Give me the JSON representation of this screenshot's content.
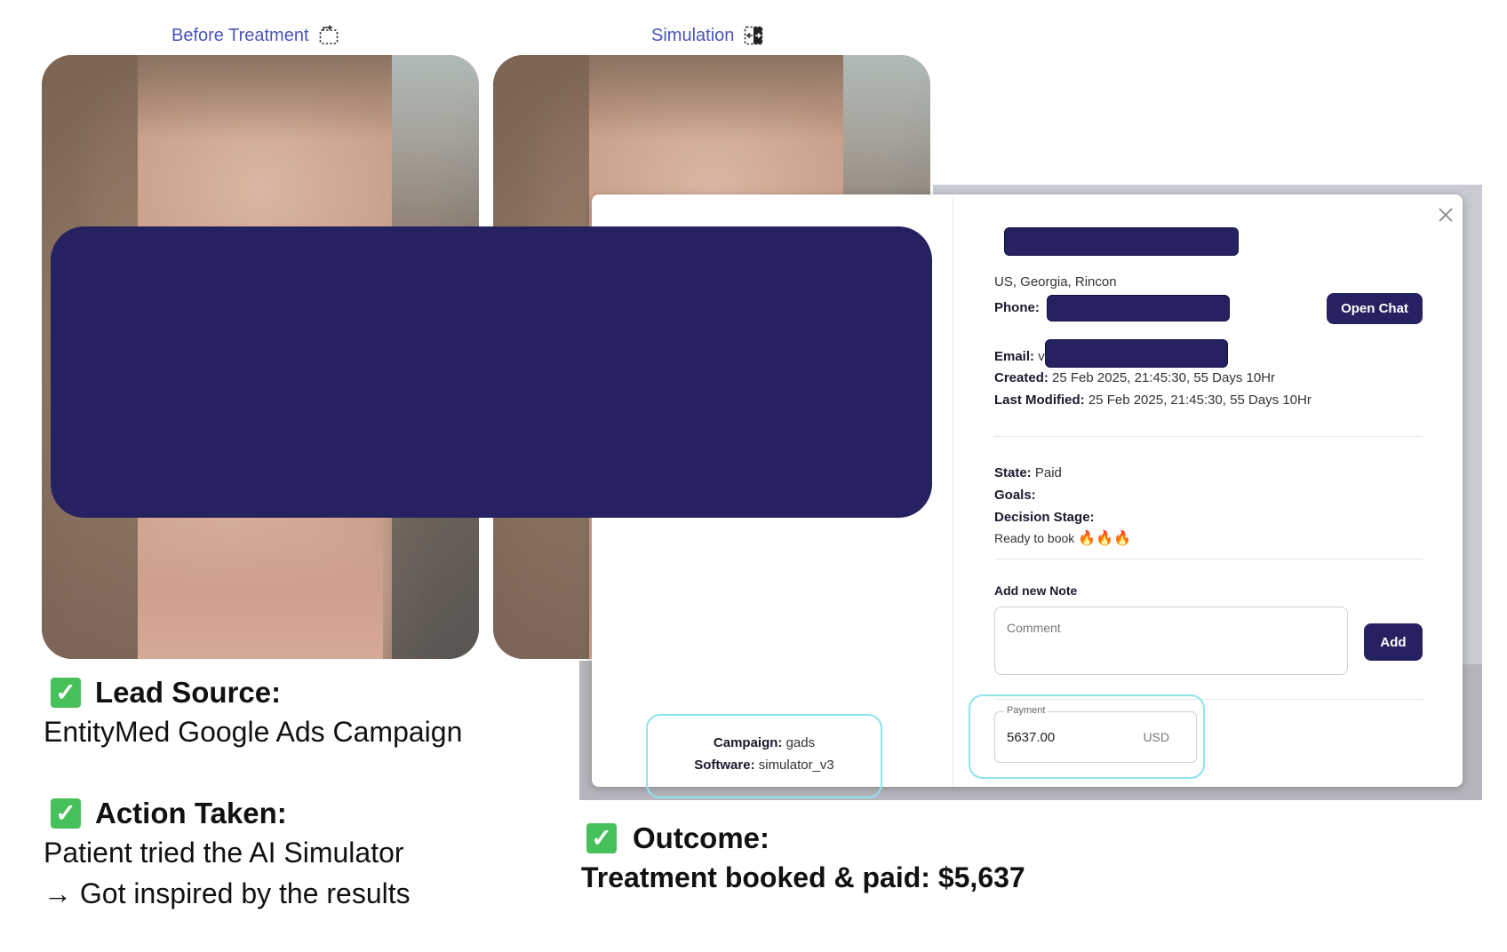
{
  "images": {
    "before_caption": "Before Treatment",
    "simulation_caption": "Simulation",
    "before_icon": "compare-flip-icon",
    "simulation_icon": "split-compare-icon"
  },
  "lead": {
    "location": "US, Georgia, Rincon",
    "phone_label": "Phone:",
    "email_label": "Email:",
    "email_prefix": "v",
    "created_label": "Created:",
    "created_value": "25 Feb 2025, 21:45:30, 55 Days 10Hr",
    "modified_label": "Last Modified:",
    "modified_value": "25 Feb 2025, 21:45:30, 55 Days 10Hr",
    "open_chat_label": "Open Chat",
    "state_label": "State:",
    "state_value": "Paid",
    "goals_label": "Goals:",
    "decision_label": "Decision Stage:",
    "decision_value": "Ready to book",
    "decision_flames": 3,
    "note_heading": "Add new Note",
    "comment_placeholder": "Comment",
    "add_label": "Add",
    "campaign_label": "Campaign:",
    "campaign_value": "gads",
    "software_label": "Software:",
    "software_value": "simulator_v3",
    "payment_legend": "Payment",
    "payment_value": "5637.00",
    "payment_currency": "USD"
  },
  "summary": {
    "lead_source_heading": "Lead Source:",
    "lead_source_text": "EntityMed Google Ads Campaign",
    "action_heading": "Action Taken:",
    "action_line1": "Patient tried the AI Simulator",
    "action_line2": "→ Got inspired by the results",
    "outcome_heading": "Outcome:",
    "outcome_text": "Treatment booked & paid: $5,637"
  },
  "colors": {
    "redaction": "#262262",
    "caption": "#4a56b8",
    "highlight_outline": "#8fe3ef",
    "check": "#46c05a"
  }
}
